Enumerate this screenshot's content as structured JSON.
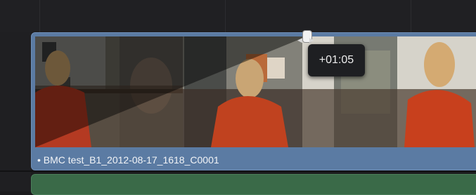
{
  "timeline": {
    "video_clip": {
      "name": "• BMC test_B1_2012-08-17_1618_C0001",
      "color": "#5b7ba3"
    },
    "audio_clip": {
      "color": "#3a6a48"
    },
    "fade_handle": {
      "tooltip": "+01:05",
      "icon": "fade-in-handle"
    }
  }
}
